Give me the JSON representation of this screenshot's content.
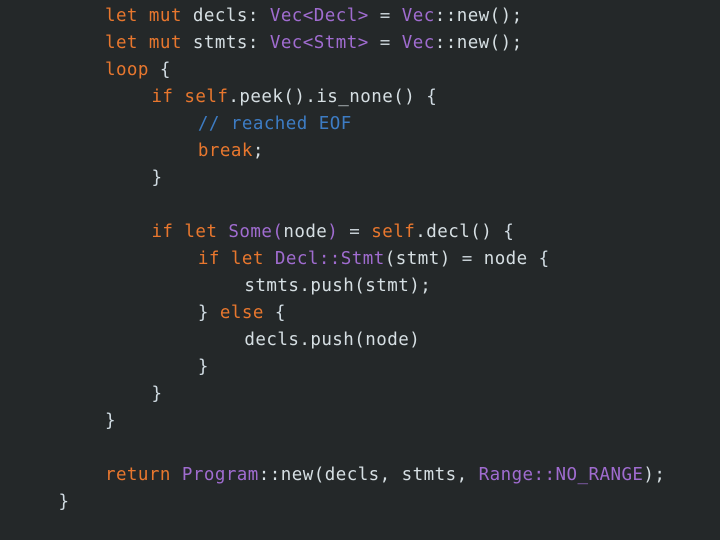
{
  "editor": {
    "language": "Rust",
    "theme": "dark",
    "background_color": "#242829",
    "colors": {
      "keyword": "#e8772e",
      "type": "#a06cd0",
      "identifier": "#d6dfe3",
      "comment": "#3d7cc4",
      "operator": "#c5ced3",
      "brace": "#d0dbe2"
    },
    "code_text": "        let mut decls: Vec<Decl> = Vec::new();\n        let mut stmts: Vec<Stmt> = Vec::new();\n        loop {\n            if self.peek().is_none() {\n                // reached EOF\n                break;\n            }\n\n            if let Some(node) = self.decl() {\n                if let Decl::Stmt(stmt) = node {\n                    stmts.push(stmt);\n                } else {\n                    decls.push(node)\n                }\n            }\n        }\n\n        return Program::new(decls, stmts, Range::NO_RANGE);\n    }",
    "lines": [
      {
        "indent": 8,
        "tokens": [
          {
            "t": "let",
            "c": "kw"
          },
          {
            "t": " ",
            "c": "punc"
          },
          {
            "t": "mut",
            "c": "kw"
          },
          {
            "t": " ",
            "c": "punc"
          },
          {
            "t": "decls",
            "c": "id"
          },
          {
            "t": ":",
            "c": "punc"
          },
          {
            "t": " ",
            "c": "punc"
          },
          {
            "t": "Vec",
            "c": "typ"
          },
          {
            "t": "<",
            "c": "typ"
          },
          {
            "t": "Decl",
            "c": "typ"
          },
          {
            "t": ">",
            "c": "typ"
          },
          {
            "t": " ",
            "c": "punc"
          },
          {
            "t": "=",
            "c": "op"
          },
          {
            "t": " ",
            "c": "punc"
          },
          {
            "t": "Vec",
            "c": "typ"
          },
          {
            "t": "::",
            "c": "id"
          },
          {
            "t": "new",
            "c": "id"
          },
          {
            "t": "()",
            "c": "paren"
          },
          {
            "t": ";",
            "c": "punc"
          }
        ]
      },
      {
        "indent": 8,
        "tokens": [
          {
            "t": "let",
            "c": "kw"
          },
          {
            "t": " ",
            "c": "punc"
          },
          {
            "t": "mut",
            "c": "kw"
          },
          {
            "t": " ",
            "c": "punc"
          },
          {
            "t": "stmts",
            "c": "id"
          },
          {
            "t": ":",
            "c": "punc"
          },
          {
            "t": " ",
            "c": "punc"
          },
          {
            "t": "Vec",
            "c": "typ"
          },
          {
            "t": "<",
            "c": "typ"
          },
          {
            "t": "Stmt",
            "c": "typ"
          },
          {
            "t": ">",
            "c": "typ"
          },
          {
            "t": " ",
            "c": "punc"
          },
          {
            "t": "=",
            "c": "op"
          },
          {
            "t": " ",
            "c": "punc"
          },
          {
            "t": "Vec",
            "c": "typ"
          },
          {
            "t": "::",
            "c": "id"
          },
          {
            "t": "new",
            "c": "id"
          },
          {
            "t": "()",
            "c": "paren"
          },
          {
            "t": ";",
            "c": "punc"
          }
        ]
      },
      {
        "indent": 8,
        "tokens": [
          {
            "t": "loop",
            "c": "kw"
          },
          {
            "t": " ",
            "c": "punc"
          },
          {
            "t": "{",
            "c": "brace"
          }
        ]
      },
      {
        "indent": 12,
        "tokens": [
          {
            "t": "if",
            "c": "kw"
          },
          {
            "t": " ",
            "c": "punc"
          },
          {
            "t": "self",
            "c": "kw"
          },
          {
            "t": ".",
            "c": "id"
          },
          {
            "t": "peek",
            "c": "id"
          },
          {
            "t": "()",
            "c": "paren"
          },
          {
            "t": ".",
            "c": "id"
          },
          {
            "t": "is_none",
            "c": "id"
          },
          {
            "t": "()",
            "c": "paren"
          },
          {
            "t": " ",
            "c": "punc"
          },
          {
            "t": "{",
            "c": "brace"
          }
        ]
      },
      {
        "indent": 16,
        "tokens": [
          {
            "t": "// reached EOF",
            "c": "cmt"
          }
        ]
      },
      {
        "indent": 16,
        "tokens": [
          {
            "t": "break",
            "c": "kw"
          },
          {
            "t": ";",
            "c": "punc"
          }
        ]
      },
      {
        "indent": 12,
        "tokens": [
          {
            "t": "}",
            "c": "brace"
          }
        ]
      },
      {
        "indent": 0,
        "tokens": []
      },
      {
        "indent": 12,
        "tokens": [
          {
            "t": "if",
            "c": "kw"
          },
          {
            "t": " ",
            "c": "punc"
          },
          {
            "t": "let",
            "c": "kw"
          },
          {
            "t": " ",
            "c": "punc"
          },
          {
            "t": "Some",
            "c": "typ"
          },
          {
            "t": "(",
            "c": "typ"
          },
          {
            "t": "node",
            "c": "id"
          },
          {
            "t": ")",
            "c": "typ"
          },
          {
            "t": " ",
            "c": "punc"
          },
          {
            "t": "=",
            "c": "op"
          },
          {
            "t": " ",
            "c": "punc"
          },
          {
            "t": "self",
            "c": "kw"
          },
          {
            "t": ".",
            "c": "id"
          },
          {
            "t": "decl",
            "c": "id"
          },
          {
            "t": "()",
            "c": "paren"
          },
          {
            "t": " ",
            "c": "punc"
          },
          {
            "t": "{",
            "c": "brace"
          }
        ]
      },
      {
        "indent": 16,
        "tokens": [
          {
            "t": "if",
            "c": "kw"
          },
          {
            "t": " ",
            "c": "punc"
          },
          {
            "t": "let",
            "c": "kw"
          },
          {
            "t": " ",
            "c": "punc"
          },
          {
            "t": "Decl",
            "c": "typ"
          },
          {
            "t": "::",
            "c": "typ"
          },
          {
            "t": "Stmt",
            "c": "typ"
          },
          {
            "t": "(",
            "c": "paren"
          },
          {
            "t": "stmt",
            "c": "id"
          },
          {
            "t": ")",
            "c": "paren"
          },
          {
            "t": " ",
            "c": "punc"
          },
          {
            "t": "=",
            "c": "op"
          },
          {
            "t": " ",
            "c": "punc"
          },
          {
            "t": "node",
            "c": "id"
          },
          {
            "t": " ",
            "c": "punc"
          },
          {
            "t": "{",
            "c": "brace"
          }
        ]
      },
      {
        "indent": 20,
        "tokens": [
          {
            "t": "stmts",
            "c": "id"
          },
          {
            "t": ".",
            "c": "id"
          },
          {
            "t": "push",
            "c": "id"
          },
          {
            "t": "(",
            "c": "paren"
          },
          {
            "t": "stmt",
            "c": "id"
          },
          {
            "t": ")",
            "c": "paren"
          },
          {
            "t": ";",
            "c": "punc"
          }
        ]
      },
      {
        "indent": 16,
        "tokens": [
          {
            "t": "}",
            "c": "brace"
          },
          {
            "t": " ",
            "c": "punc"
          },
          {
            "t": "else",
            "c": "kw"
          },
          {
            "t": " ",
            "c": "punc"
          },
          {
            "t": "{",
            "c": "brace"
          }
        ]
      },
      {
        "indent": 20,
        "tokens": [
          {
            "t": "decls",
            "c": "id"
          },
          {
            "t": ".",
            "c": "id"
          },
          {
            "t": "push",
            "c": "id"
          },
          {
            "t": "(",
            "c": "paren"
          },
          {
            "t": "node",
            "c": "id"
          },
          {
            "t": ")",
            "c": "paren"
          }
        ]
      },
      {
        "indent": 16,
        "tokens": [
          {
            "t": "}",
            "c": "brace"
          }
        ]
      },
      {
        "indent": 12,
        "tokens": [
          {
            "t": "}",
            "c": "brace"
          }
        ]
      },
      {
        "indent": 8,
        "tokens": [
          {
            "t": "}",
            "c": "brace"
          }
        ]
      },
      {
        "indent": 0,
        "tokens": []
      },
      {
        "indent": 8,
        "tokens": [
          {
            "t": "return",
            "c": "kw"
          },
          {
            "t": " ",
            "c": "punc"
          },
          {
            "t": "Program",
            "c": "typ"
          },
          {
            "t": "::",
            "c": "id"
          },
          {
            "t": "new",
            "c": "id"
          },
          {
            "t": "(",
            "c": "paren"
          },
          {
            "t": "decls",
            "c": "id"
          },
          {
            "t": ",",
            "c": "punc"
          },
          {
            "t": " ",
            "c": "punc"
          },
          {
            "t": "stmts",
            "c": "id"
          },
          {
            "t": ",",
            "c": "punc"
          },
          {
            "t": " ",
            "c": "punc"
          },
          {
            "t": "Range",
            "c": "typ"
          },
          {
            "t": "::",
            "c": "typ"
          },
          {
            "t": "NO_RANGE",
            "c": "typ"
          },
          {
            "t": ")",
            "c": "paren"
          },
          {
            "t": ";",
            "c": "punc"
          }
        ]
      },
      {
        "indent": 4,
        "tokens": [
          {
            "t": "}",
            "c": "brace"
          }
        ]
      }
    ]
  }
}
